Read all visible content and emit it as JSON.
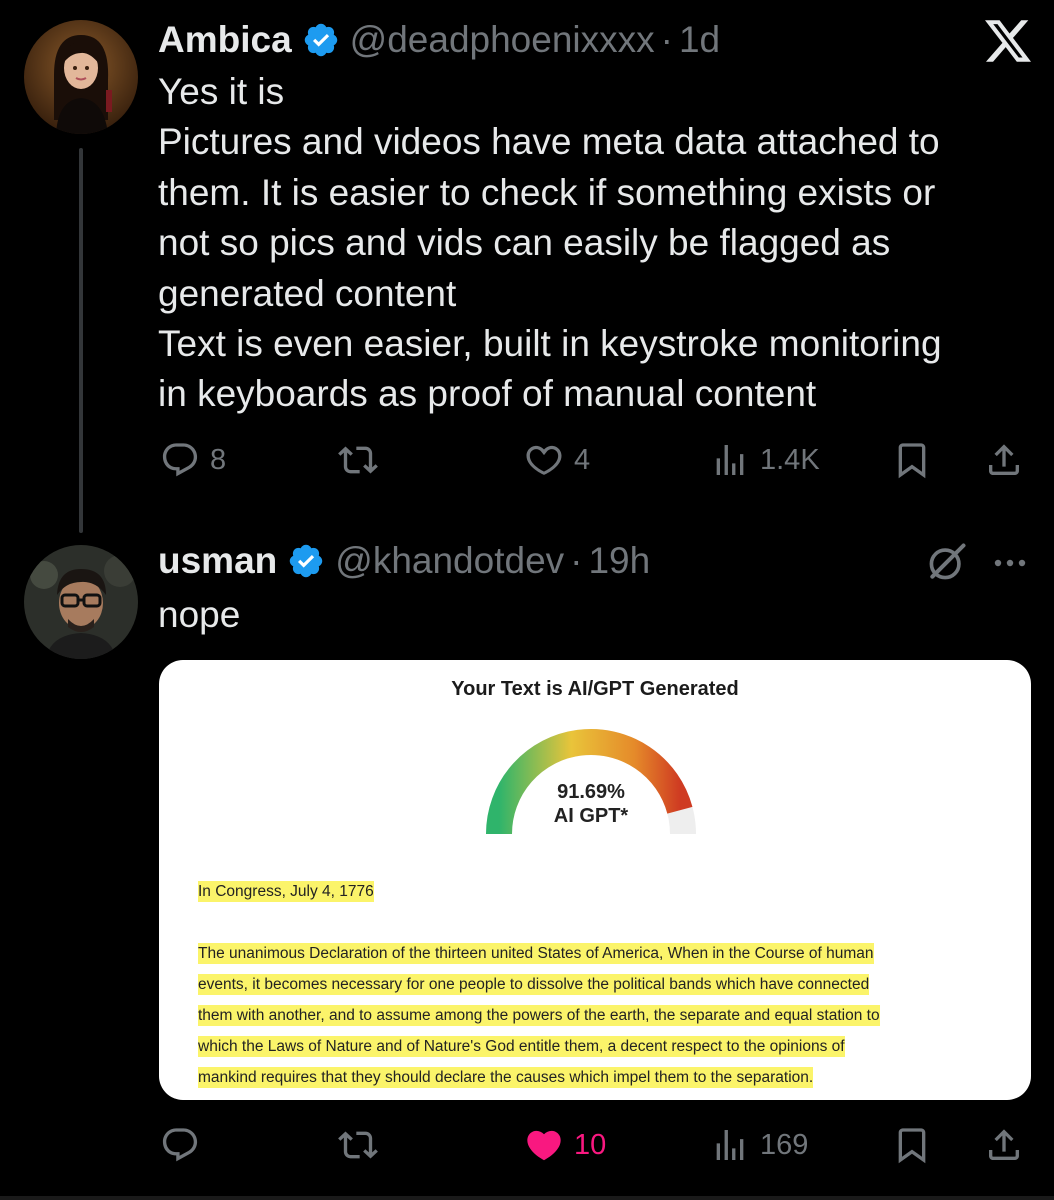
{
  "tweet1": {
    "author_name": "Ambica",
    "handle": "@deadphoenixxxx",
    "separator": "·",
    "time": "1d",
    "lines": [
      "Yes it is",
      "Pictures and videos have meta data attached to",
      "them. It is easier to check if something exists or",
      "not so pics and vids can easily be flagged as",
      "generated content",
      "Text is even easier, built in keystroke monitoring",
      "in keyboards as proof of manual content"
    ],
    "actions": {
      "replies": "8",
      "reposts": "",
      "likes": "4",
      "views": "1.4K"
    },
    "icons": [
      "reply-icon",
      "repost-icon",
      "like-icon",
      "views-icon",
      "bookmark-icon",
      "share-icon"
    ]
  },
  "tweet2": {
    "author_name": "usman",
    "handle": "@khandotdev",
    "separator": "·",
    "time": "19h",
    "text": "nope",
    "actions": {
      "replies": "",
      "reposts": "",
      "likes": "10",
      "views": "169"
    },
    "liked": true
  },
  "card": {
    "title": "Your Text is AI/GPT Generated",
    "gauge_percent": 91.69,
    "gauge_value": "91.69%",
    "gauge_label": "AI GPT*",
    "date_line": "In Congress, July 4, 1776",
    "paragraph_lines": [
      "The unanimous Declaration of the thirteen united States of America, When in the Course of human",
      "events, it becomes necessary for one people to dissolve the political bands which have connected",
      "them with another, and to assume among the powers of the earth, the separate and equal station to",
      "which the Laws of Nature and of Nature's God entitle them, a decent respect to the opinions of",
      "mankind requires that they should declare the causes which impel them to the separation."
    ]
  },
  "colors": {
    "background": "#000000",
    "text_primary": "#e7e9ea",
    "text_secondary": "#71767b",
    "verified_blue": "#1d9bf0",
    "like_pink": "#f91880",
    "highlight_yellow": "#fbf46a"
  }
}
